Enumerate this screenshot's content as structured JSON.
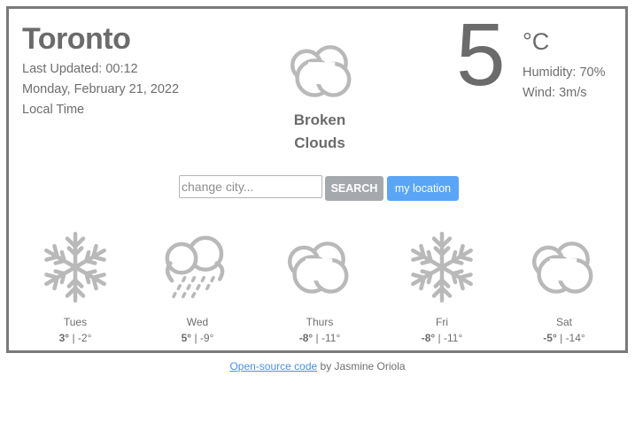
{
  "city": "Toronto",
  "last_updated": "Last Updated: 00:12",
  "date": "Monday, February 21, 2022",
  "local_time": "Local Time",
  "current": {
    "description_line1": "Broken",
    "description_line2": "Clouds",
    "icon": "broken-clouds-icon",
    "temperature": "5",
    "unit": "°C",
    "humidity": "Humidity: 70%",
    "wind": "Wind: 3m/s"
  },
  "search": {
    "placeholder": "change city...",
    "value": "",
    "search_label": "SEARCH",
    "location_label": "my location"
  },
  "forecast": [
    {
      "day": "Tues",
      "high": "3°",
      "low": "-2°",
      "icon": "snowflake-icon"
    },
    {
      "day": "Wed",
      "high": "5°",
      "low": "-9°",
      "icon": "snow-cloud-icon"
    },
    {
      "day": "Thurs",
      "high": "-8°",
      "low": "-11°",
      "icon": "broken-clouds-icon"
    },
    {
      "day": "Fri",
      "high": "-8°",
      "low": "-11°",
      "icon": "snowflake-icon"
    },
    {
      "day": "Sat",
      "high": "-5°",
      "low": "-14°",
      "icon": "broken-clouds-icon"
    }
  ],
  "separator": "|",
  "footer": {
    "link_text": "Open-source code",
    "by_text": "by Jasmine Oriola"
  },
  "colors": {
    "icon_gray": "#b9b9b9",
    "text_gray": "#6e6e6e",
    "search_button": "#a5a9ad",
    "location_button": "#5aa5f5",
    "link": "#4a8fe7"
  }
}
